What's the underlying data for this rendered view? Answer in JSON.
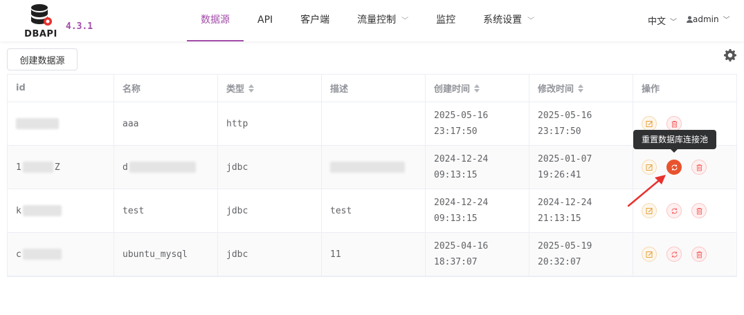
{
  "app": {
    "logo_text": "DBAPI",
    "version": "4.3.1"
  },
  "nav": {
    "items": [
      {
        "label": "数据源",
        "active": true,
        "dropdown": false
      },
      {
        "label": "API",
        "active": false,
        "dropdown": false
      },
      {
        "label": "客户端",
        "active": false,
        "dropdown": false
      },
      {
        "label": "流量控制",
        "active": false,
        "dropdown": true
      },
      {
        "label": "监控",
        "active": false,
        "dropdown": false
      },
      {
        "label": "系统设置",
        "active": false,
        "dropdown": true
      }
    ],
    "language": "中文",
    "user": "admin"
  },
  "toolbar": {
    "create_label": "创建数据源",
    "settings_icon": "gear-icon"
  },
  "table": {
    "headers": [
      "id",
      "名称",
      "类型",
      "描述",
      "创建时间",
      "修改时间",
      "操作"
    ],
    "sortable_columns": [
      "类型",
      "创建时间",
      "修改时间"
    ],
    "rows": [
      {
        "id_prefix": "",
        "id_suffix": "",
        "name": "aaa",
        "type": "http",
        "desc": "",
        "created_date": "2025-05-16",
        "created_time": "23:17:50",
        "modified_date": "2025-05-16",
        "modified_time": "23:17:50",
        "actions": [
          "edit",
          "delete"
        ]
      },
      {
        "id_prefix": "1",
        "id_suffix": "Z",
        "name": "d",
        "type": "jdbc",
        "desc": "",
        "created_date": "2024-12-24",
        "created_time": "09:13:15",
        "modified_date": "2025-01-07",
        "modified_time": "19:26:41",
        "actions": [
          "edit",
          "reset",
          "delete"
        ]
      },
      {
        "id_prefix": "k",
        "id_suffix": "",
        "name": "test",
        "type": "jdbc",
        "desc": "test",
        "created_date": "2024-12-24",
        "created_time": "09:13:15",
        "modified_date": "2024-12-24",
        "modified_time": "21:13:15",
        "actions": [
          "edit",
          "reset",
          "delete"
        ]
      },
      {
        "id_prefix": "c",
        "id_suffix": "",
        "name": "ubuntu_mysql",
        "type": "jdbc",
        "desc": "11",
        "created_date": "2025-04-16",
        "created_time": "18:37:07",
        "modified_date": "2025-05-19",
        "modified_time": "20:32:07",
        "actions": [
          "edit",
          "reset",
          "delete"
        ]
      }
    ]
  },
  "tooltip": {
    "text": "重置数据库连接池"
  },
  "colors": {
    "accent": "#a24ba8",
    "edit": "#e6a23c",
    "danger": "#f56c6c",
    "reset_active": "#e8532e",
    "annotation_arrow": "#e8312e"
  }
}
